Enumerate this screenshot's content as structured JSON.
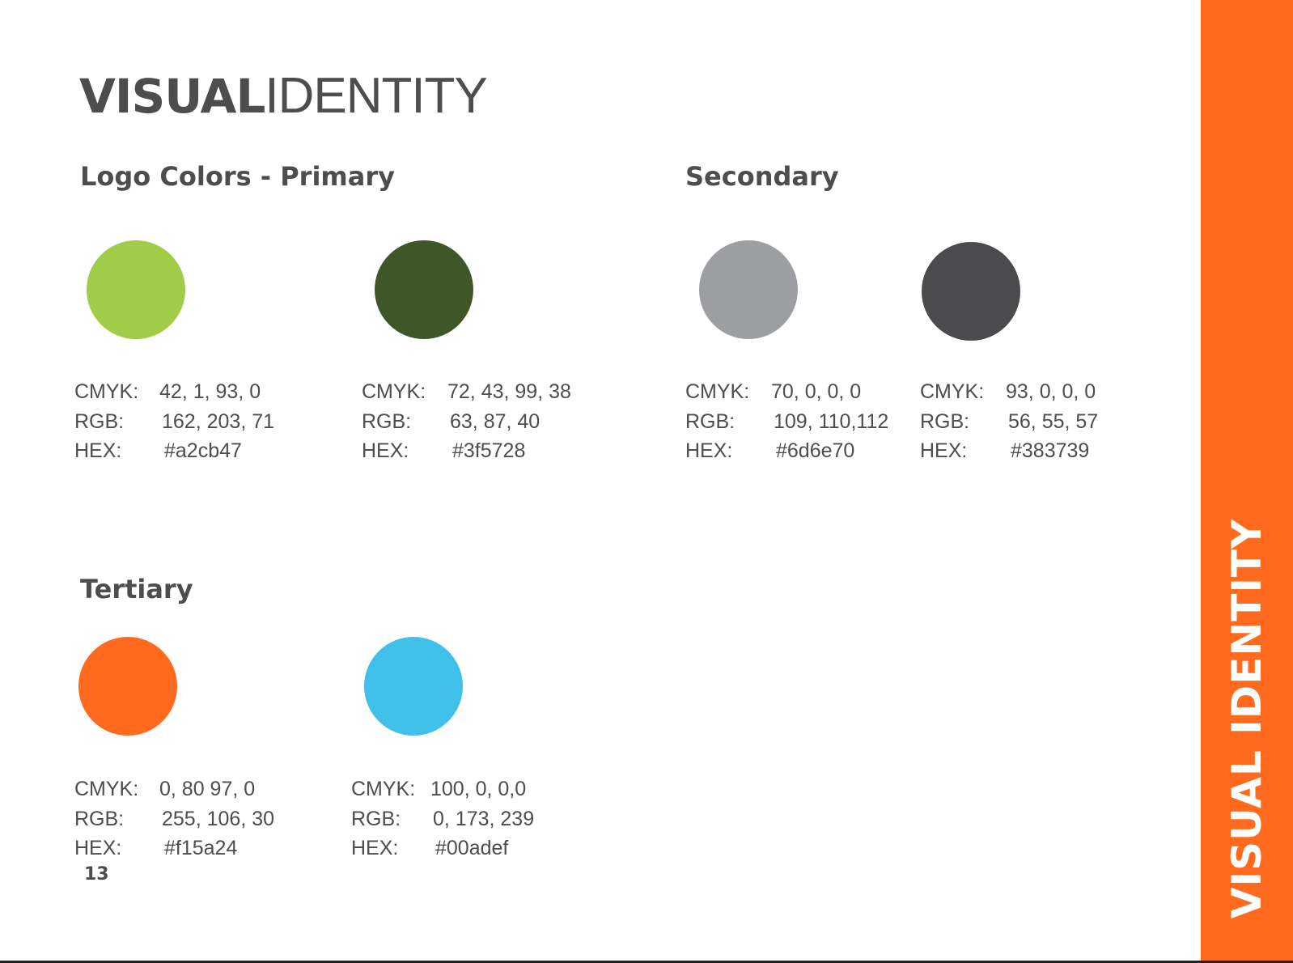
{
  "title": {
    "bold": "VISUAL",
    "light": "IDENTITY"
  },
  "sections": {
    "primary": "Logo Colors - Primary",
    "secondary": "Secondary",
    "tertiary": "Tertiary"
  },
  "labels": {
    "cmyk": "CMYK:",
    "rgb": "RGB:",
    "hex": "HEX:"
  },
  "swatches": [
    {
      "color": "#a2cb47",
      "cmyk": "42, 1, 93, 0",
      "rgb": "162, 203, 71",
      "hex": "#a2cb47"
    },
    {
      "color": "#3f5728",
      "cmyk": "72, 43, 99, 38",
      "rgb": "63, 87, 40",
      "hex": "#3f5728"
    },
    {
      "color": "#9d9ea1",
      "cmyk": "70, 0, 0, 0",
      "rgb": "109, 110,112",
      "hex": "#6d6e70"
    },
    {
      "color": "#4b4b4d",
      "cmyk": "93, 0, 0, 0",
      "rgb": "56, 55, 57",
      "hex": "#383739"
    },
    {
      "color": "#ff6a1e",
      "cmyk": "0, 80 97, 0",
      "rgb": "255, 106, 30",
      "hex": "#f15a24"
    },
    {
      "color": "#41c1ea",
      "cmyk": "100, 0, 0,0",
      "rgb": "0, 173, 239",
      "hex": "#00adef"
    }
  ],
  "page_number": "13",
  "sidebar": {
    "label": "VISUAL IDENTITY",
    "color": "#ff6a1e"
  }
}
